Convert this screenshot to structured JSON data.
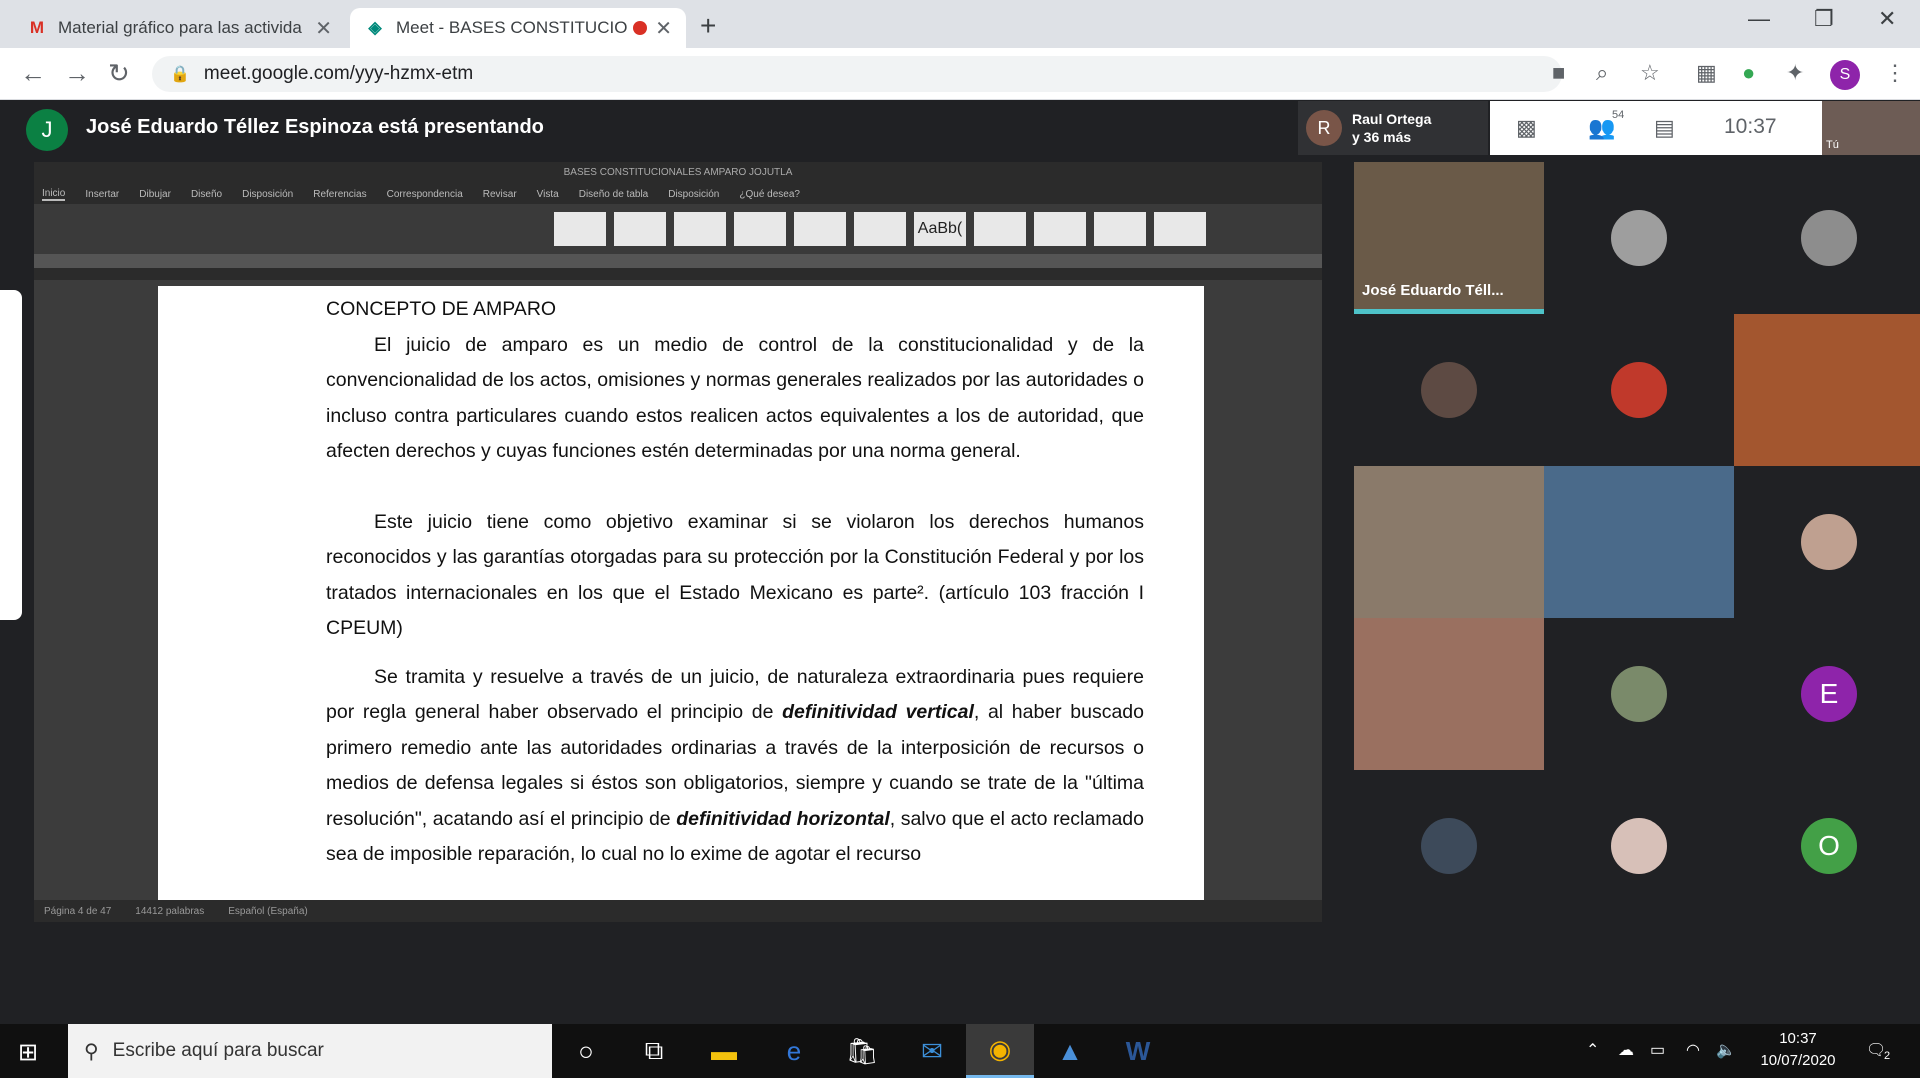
{
  "tabs": [
    {
      "title": "Material gráfico para las activida",
      "icon": "gmail-icon"
    },
    {
      "title": "Meet - BASES CONSTITUCIO",
      "icon": "meet-icon"
    }
  ],
  "url": "meet.google.com/yyy-hzmx-etm",
  "profile_initial": "S",
  "meet": {
    "presenter_initial": "J",
    "presenter_text": "José Eduardo Téllez Espinoza está presentando",
    "raised": {
      "initial": "R",
      "name": "Raul Ortega",
      "more": "y 36 más"
    },
    "participants_count": "54",
    "time": "10:37",
    "self_label": "Tú"
  },
  "word": {
    "title_bar": "BASES CONSTITUCIONALES AMPARO JOJUTLA",
    "menu": [
      "Inicio",
      "Insertar",
      "Dibujar",
      "Diseño",
      "Disposición",
      "Referencias",
      "Correspondencia",
      "Revisar",
      "Vista",
      "Diseño de tabla",
      "Disposición",
      "¿Qué desea?"
    ],
    "big_style": "AaBb(",
    "status": [
      "Página 4 de 47",
      "14412 palabras",
      "Español (España)"
    ]
  },
  "doc": {
    "heading": "CONCEPTO DE AMPARO",
    "p1": "El juicio de amparo es un medio de control de la constitucionalidad y de la convencionalidad de los actos, omisiones y normas generales realizados por las autoridades o incluso contra particulares cuando estos realicen actos equivalentes a los de autoridad, que afecten derechos y cuyas funciones estén determinadas por una norma general.",
    "p2": "Este juicio tiene como objetivo examinar si se violaron los derechos humanos reconocidos y las garantías otorgadas para su protección por la Constitución Federal y por los tratados internacionales en los que el Estado Mexicano es parte². (artículo 103 fracción I CPEUM)",
    "p3_a": "Se tramita y resuelve a través de un juicio, de naturaleza extraordinaria pues requiere por regla general haber observado el principio de ",
    "p3_b": "definitividad vertical",
    "p3_c": ", al haber buscado primero remedio ante las autoridades ordinarias a través de la interposición de recursos o medios de defensa legales si éstos son obligatorios, siempre y cuando se trate de la \"última resolución\", acatando así el principio de ",
    "p3_d": "definitividad horizontal",
    "p3_e": ", salvo que el acto reclamado sea de imposible reparación, lo cual no lo exime de agotar el recurso"
  },
  "tiles": [
    {
      "type": "video",
      "name": "José Eduardo Téll...",
      "color": "#6a5a48",
      "speaking": true
    },
    {
      "type": "avatar",
      "color": "#9e9e9e"
    },
    {
      "type": "avatar",
      "color": "#8d8d8d"
    },
    {
      "type": "avatar",
      "color": "#5d4a43"
    },
    {
      "type": "avatar",
      "color": "#c0392b"
    },
    {
      "type": "video",
      "color": "#a3562f"
    },
    {
      "type": "video",
      "color": "#8a7a6a"
    },
    {
      "type": "video",
      "color": "#4a6a8a"
    },
    {
      "type": "avatar",
      "color": "#bfa090"
    },
    {
      "type": "video",
      "color": "#9a7060"
    },
    {
      "type": "avatar",
      "color": "#7a8a6a"
    },
    {
      "type": "letter",
      "letter": "E",
      "color": "#8e24aa"
    },
    {
      "type": "avatar",
      "color": "#3d4a5a"
    },
    {
      "type": "avatar",
      "color": "#d7c0b8"
    },
    {
      "type": "letter",
      "letter": "O",
      "color": "#43a047"
    }
  ],
  "taskbar": {
    "search_placeholder": "Escribe aquí para buscar",
    "time": "10:37",
    "date": "10/07/2020",
    "notifications": "2"
  }
}
